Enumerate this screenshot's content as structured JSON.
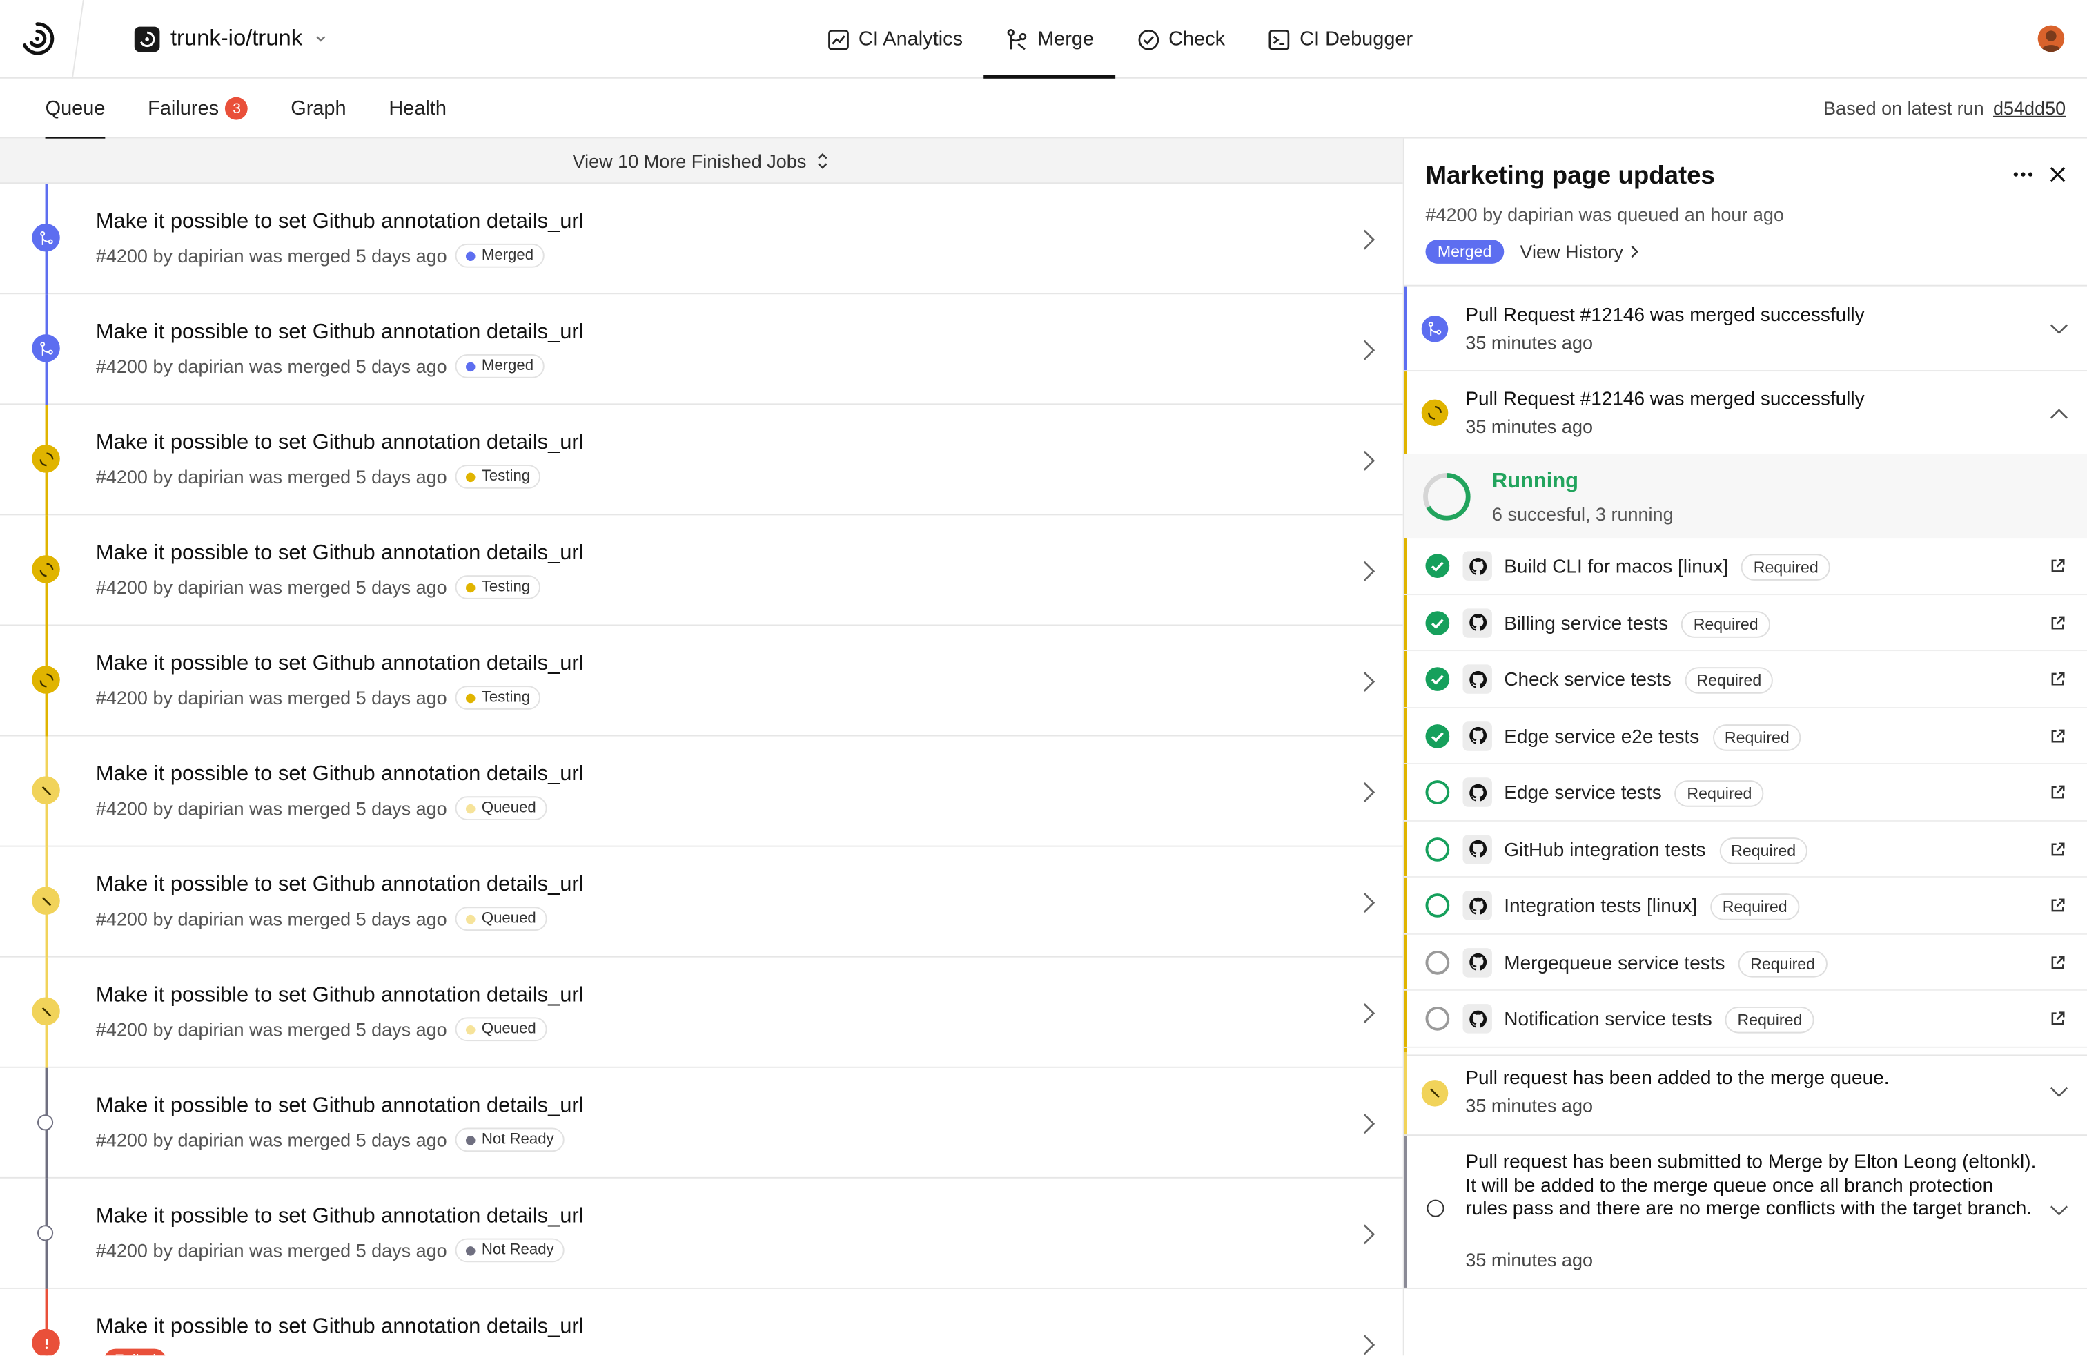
{
  "header": {
    "repo": "trunk-io/trunk",
    "nav": [
      {
        "label": "CI Analytics",
        "icon": "chart-icon"
      },
      {
        "label": "Merge",
        "icon": "merge-icon",
        "active": true
      },
      {
        "label": "Check",
        "icon": "check-circle-icon"
      },
      {
        "label": "CI Debugger",
        "icon": "terminal-icon"
      }
    ]
  },
  "subnav": {
    "tabs": [
      {
        "label": "Queue",
        "active": true
      },
      {
        "label": "Failures",
        "badge": "3"
      },
      {
        "label": "Graph"
      },
      {
        "label": "Health"
      }
    ],
    "based_on_label": "Based on latest run",
    "commit": "d54dd50"
  },
  "queue": {
    "view_more": "View 10 More Finished Jobs",
    "items": [
      {
        "title": "Make it possible to set Github annotation details_url",
        "meta": "#4200 by dapirian was merged 5 days ago",
        "status": "Merged"
      },
      {
        "title": "Make it possible to set Github annotation details_url",
        "meta": "#4200 by dapirian was merged 5 days ago",
        "status": "Merged"
      },
      {
        "title": "Make it possible to set Github annotation details_url",
        "meta": "#4200 by dapirian was merged 5 days ago",
        "status": "Testing"
      },
      {
        "title": "Make it possible to set Github annotation details_url",
        "meta": "#4200 by dapirian was merged 5 days ago",
        "status": "Testing"
      },
      {
        "title": "Make it possible to set Github annotation details_url",
        "meta": "#4200 by dapirian was merged 5 days ago",
        "status": "Testing"
      },
      {
        "title": "Make it possible to set Github annotation details_url",
        "meta": "#4200 by dapirian was merged 5 days ago",
        "status": "Queued"
      },
      {
        "title": "Make it possible to set Github annotation details_url",
        "meta": "#4200 by dapirian was merged 5 days ago",
        "status": "Queued"
      },
      {
        "title": "Make it possible to set Github annotation details_url",
        "meta": "#4200 by dapirian was merged 5 days ago",
        "status": "Queued"
      },
      {
        "title": "Make it possible to set Github annotation details_url",
        "meta": "#4200 by dapirian was merged 5 days ago",
        "status": "Not Ready"
      },
      {
        "title": "Make it possible to set Github annotation details_url",
        "meta": "#4200 by dapirian was merged 5 days ago",
        "status": "Not Ready"
      },
      {
        "title": "Make it possible to set Github annotation details_url",
        "meta": "",
        "status": "Failed"
      }
    ]
  },
  "detail": {
    "title": "Marketing page updates",
    "subtitle": "#4200 by dapirian was queued an hour ago",
    "status": "Merged",
    "history_label": "View History",
    "events": [
      {
        "title": "Pull Request #12146 was merged successfully",
        "time": "35 minutes ago"
      },
      {
        "title": "Pull Request #12146 was merged successfully",
        "time": "35 minutes ago"
      },
      {
        "title": "Pull request has been added to the merge queue.",
        "time": "35 minutes ago"
      },
      {
        "title": "Pull request has been submitted to Merge by Elton Leong (eltonkl). It will be added to the merge queue once all branch protection rules pass and there are no merge conflicts with the target branch.",
        "time": "35 minutes ago"
      }
    ],
    "running": {
      "label": "Running",
      "summary": "6 succesful, 3 running",
      "succeeded": 6,
      "running": 3
    },
    "jobs": [
      {
        "name": "Build CLI for macos [linux]",
        "tag": "Required",
        "state": "success"
      },
      {
        "name": "Billing service tests",
        "tag": "Required",
        "state": "success"
      },
      {
        "name": "Check service tests",
        "tag": "Required",
        "state": "success"
      },
      {
        "name": "Edge service e2e tests",
        "tag": "Required",
        "state": "success"
      },
      {
        "name": "Edge service tests",
        "tag": "Required",
        "state": "running"
      },
      {
        "name": "GitHub integration tests",
        "tag": "Required",
        "state": "running"
      },
      {
        "name": "Integration tests [linux]",
        "tag": "Required",
        "state": "running"
      },
      {
        "name": "Mergequeue service tests",
        "tag": "Required",
        "state": "pending"
      },
      {
        "name": "Notification service tests",
        "tag": "Required",
        "state": "pending"
      }
    ]
  },
  "colors": {
    "merged": "#5d6ef0",
    "testing": "#e0b400",
    "queued": "#f1d35a",
    "not_ready": "#6f6f80",
    "failed": "#e9503a",
    "success": "#16a05c"
  }
}
